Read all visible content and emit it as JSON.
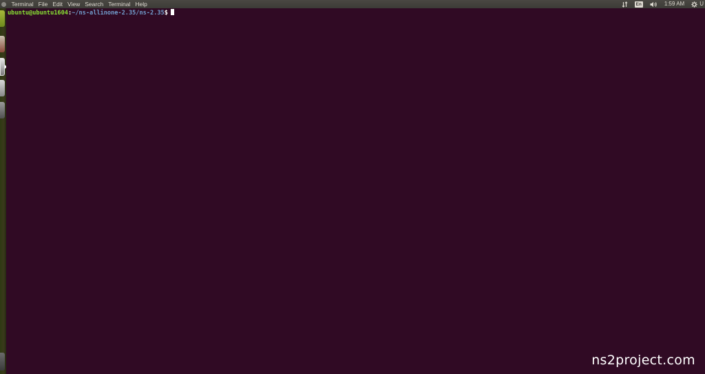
{
  "app": {
    "name": "Terminal"
  },
  "menubar": {
    "items": [
      "Terminal",
      "File",
      "Edit",
      "View",
      "Search",
      "Terminal",
      "Help"
    ]
  },
  "indicators": {
    "network_icon": "network-arrows-icon",
    "keyboard_layout": "En",
    "volume_icon": "speaker-icon",
    "clock": "1:59 AM",
    "session_icon": "gear-icon",
    "session_label": "U"
  },
  "launcher": {
    "icons": [
      "terminal-icon",
      "files-icon",
      "browser-icon",
      "text-editor-icon",
      "settings-icon",
      "trash-icon"
    ]
  },
  "terminal": {
    "user_host": "ubuntu@ubuntu1604",
    "colon": ":",
    "path": "~/ns-allinone-2.35/ns-2.35",
    "prompt_symbol": "$"
  },
  "watermark": "ns2project.com",
  "colors": {
    "background": "#300a24",
    "user_host": "#8ae234",
    "path": "#729fcf",
    "panel": "#3c3b37"
  }
}
